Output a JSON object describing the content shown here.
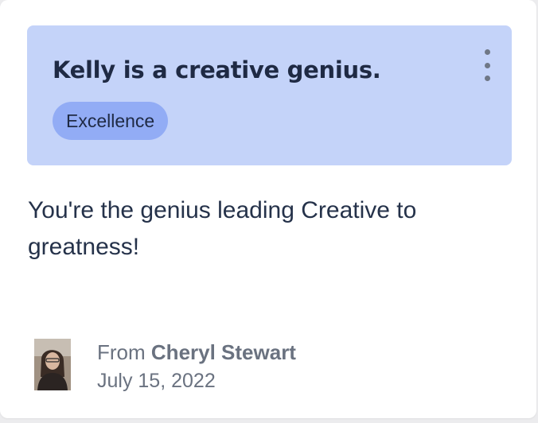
{
  "card": {
    "title": "Kelly is a creative genius.",
    "badge": "Excellence",
    "message": "You're the genius leading Creative to greatness!",
    "menu_icon": "more-vertical-icon",
    "sender": {
      "from_label": "From",
      "name": "Cheryl Stewart",
      "date": "July 15, 2022",
      "avatar_icon": "user-photo"
    }
  },
  "colors": {
    "banner_bg": "#c4d3f9",
    "badge_bg": "#92acf5",
    "title_text": "#1f2a44",
    "muted_text": "#6a7280"
  }
}
